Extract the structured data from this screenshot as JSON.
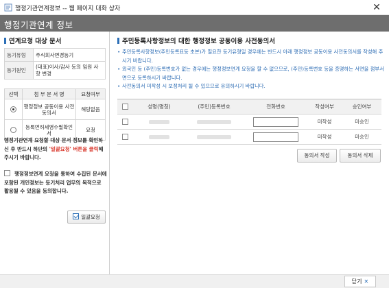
{
  "window": {
    "title": "행정기관연계정보 -- 웹 페이지 대화 상자",
    "close_glyph": "✕"
  },
  "header": {
    "title": "행정기관연계 정보"
  },
  "left": {
    "title": "연계요청 대상 문서",
    "info": [
      {
        "label": "등기유형",
        "value": "주식회사변경등기"
      },
      {
        "label": "등기원인",
        "value": "(대표)이사/감사 등의 임원 사항 변경"
      }
    ],
    "doc_table": {
      "headers": [
        "선택",
        "첨 부 문 서 명",
        "요청여부"
      ],
      "rows": [
        {
          "selected": true,
          "name": "행정정보 공동이용 사전동의서",
          "status": "해당없음"
        },
        {
          "selected": false,
          "name": "등록면허세영수필확인서",
          "status": "요청"
        }
      ]
    },
    "notice_pre": "행정기관연계 요청할 대상 문서 정보를 확인하신 후 반드시 하단의 ",
    "notice_red": "'일괄요청' 버튼을 클릭",
    "notice_post": "해 주시기 바랍니다.",
    "consent_text": "행정정보연계 요청을 통하여 수집된 문서에 포함된 개인정보는 등기처리 업무의 목적으로 활용될 수 있음을 동의합니다.",
    "apply_button": "일괄요청"
  },
  "right": {
    "title": "주민등록사항정보의 대한 행정정보 공동이용 사전동의서",
    "bullets": [
      "주민등록사항정보(주민등록표등 초본)가 필요한 등기유형일 경우에는 반드시 아래 행정정보 공동이용 사전동의서를 작성해 주시기 바랍니다.",
      "외국인 등 (주민)등록번호가 없는 경우에는 행정정보연계 요청을 할 수 없으므로, (주민)등록번호 등을 증명하는 서면을 첨부서면으로 등록하시기 바랍니다.",
      "사전동의서 미작성 시 보정처리 될 수 있으므로 유의하시기 바랍니다."
    ],
    "table": {
      "headers": [
        "성명(명칭)",
        "(주민)등록번호",
        "전화번호",
        "작성여부",
        "승인여부"
      ],
      "rows": [
        {
          "written": "미작성",
          "approved": "미승인"
        },
        {
          "written": "미작성",
          "approved": "미승인"
        }
      ]
    },
    "write_button": "동의서 작성",
    "delete_button": "동의서 삭제"
  },
  "footer": {
    "close_button": "닫기"
  },
  "colors": {
    "accent": "#2c6fb7",
    "header_bg": "#6e6e6e",
    "notice_red": "#d9382c"
  }
}
